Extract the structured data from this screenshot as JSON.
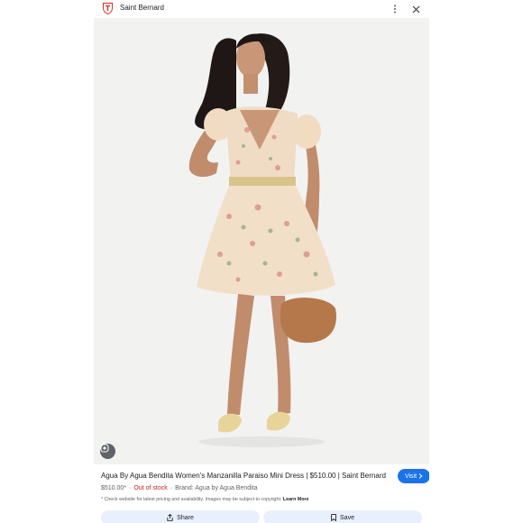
{
  "header": {
    "site_name": "Saint Bernard",
    "favicon_icon": "shield-crest-icon",
    "more_icon": "more-vertical-icon",
    "close_icon": "close-icon"
  },
  "image": {
    "description_icon": "product-photo",
    "lens_icon": "google-lens-icon"
  },
  "product": {
    "title": "Agua By Agua Bendita Women's Manzanilla Paraiso Mini Dress | $510.00 | Saint Bernard",
    "price": "$510.00*",
    "stock": "Out of stock",
    "brand": "Brand: Agua by Agua Bendita",
    "disclaimer": "* Check website for latest pricing and availability. Images may be subject to copyright.",
    "learn_more": "Learn More"
  },
  "actions": {
    "visit_label": "Visit",
    "share_label": "Share",
    "save_label": "Save"
  },
  "colors": {
    "accent": "#1a73e8",
    "out_of_stock": "#c5221f",
    "action_bg": "#e8f0fe"
  }
}
